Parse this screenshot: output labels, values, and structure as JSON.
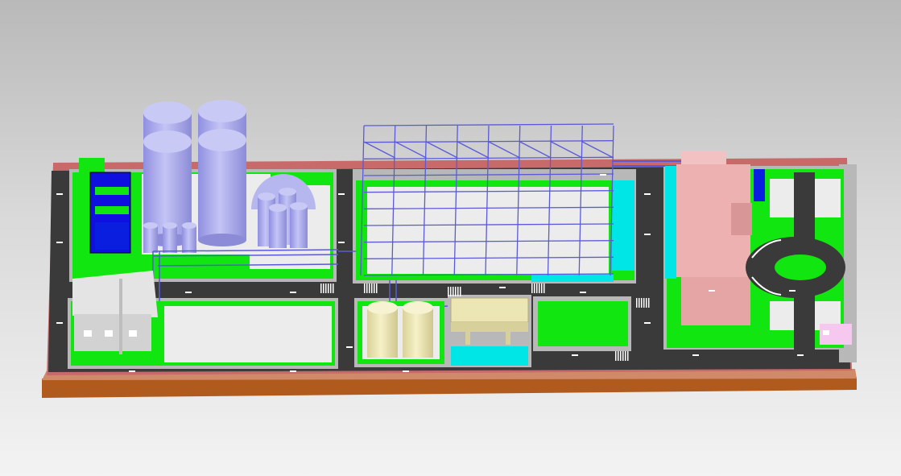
{
  "viewport": {
    "background_top": "#b9b9b9",
    "background_bottom": "#f3f3f3"
  },
  "scene": {
    "colors": {
      "base_slab": "#b05a1e",
      "site_border": "#c96a6a",
      "road": "#3a3a3a",
      "road_marking": "#ffffff",
      "curb": "#b8b8b8",
      "grass": "#11e611",
      "pavement": "#ececec",
      "storage_tank": "#a9a9ee",
      "small_tank": "#b7b7f0",
      "pipe_rack": "#5a5ad8",
      "water_pool": "#0a1ee0",
      "cyan_zone": "#00e5e5",
      "cream_tank": "#ece6b4",
      "pink_building": "#eeb1b1",
      "warehouse": "#dcdcdc",
      "light_pink_kiosk": "#f6c8f0"
    },
    "objects": [
      {
        "name": "large-storage-tank",
        "count": 4
      },
      {
        "name": "small-storage-tank",
        "count": 3
      },
      {
        "name": "spherical-tank-cluster",
        "count": 1
      },
      {
        "name": "pipe-rack-structure",
        "count": 1
      },
      {
        "name": "water-treatment-pool",
        "count": 1
      },
      {
        "name": "warehouse-building",
        "count": 1
      },
      {
        "name": "cream-tank",
        "count": 2
      },
      {
        "name": "equipment-skid",
        "count": 1
      },
      {
        "name": "office-building",
        "count": 1
      },
      {
        "name": "roundabout",
        "count": 1
      },
      {
        "name": "guard-kiosk",
        "count": 1
      }
    ]
  }
}
